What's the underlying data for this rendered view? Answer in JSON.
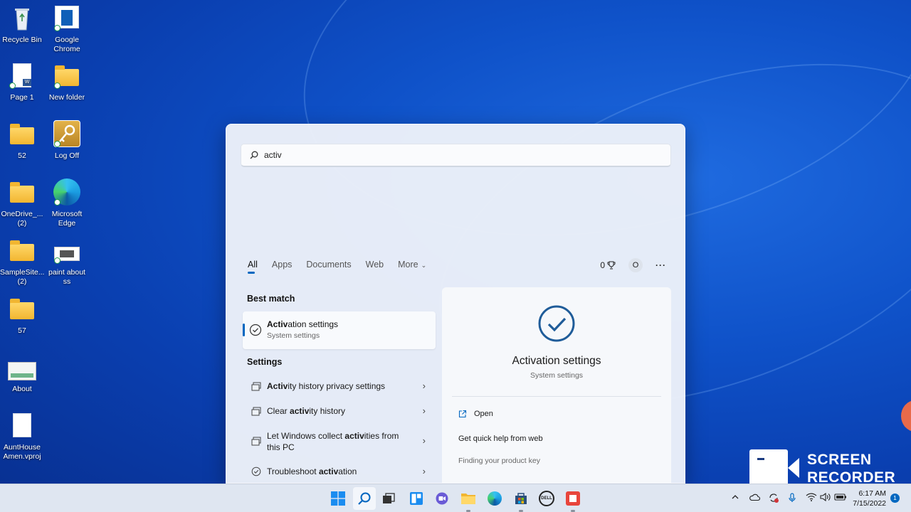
{
  "desktop": {
    "icons": [
      {
        "label": "Recycle Bin"
      },
      {
        "label": "Google\nChrome"
      },
      {
        "label": "Page 1"
      },
      {
        "label": "New folder"
      },
      {
        "label": "52"
      },
      {
        "label": "Log Off"
      },
      {
        "label": "OneDrive_...\n(2)"
      },
      {
        "label": "Microsoft\nEdge"
      },
      {
        "label": "SampleSite...\n(2)"
      },
      {
        "label": "paint about\nss"
      },
      {
        "label": "57"
      },
      {
        "label": "About"
      },
      {
        "label": "AuntHouse\nAmen.vproj"
      }
    ]
  },
  "search": {
    "value": "activ"
  },
  "tabs": [
    {
      "label": "All"
    },
    {
      "label": "Apps"
    },
    {
      "label": "Documents"
    },
    {
      "label": "Web"
    },
    {
      "label": "More"
    }
  ],
  "toolbar": {
    "points": "0",
    "profile_initial": "O",
    "more_label": "···"
  },
  "best_match": {
    "heading": "Best match",
    "title_bold": "Activ",
    "title_rest": "ation settings",
    "subtitle": "System settings"
  },
  "settings": {
    "heading": "Settings",
    "items": [
      {
        "pre": "",
        "bold": "Activ",
        "post": "ity history privacy settings"
      },
      {
        "pre": "Clear ",
        "bold": "activ",
        "post": "ity history"
      },
      {
        "pre": "Let Windows collect ",
        "bold": "activ",
        "post": "ities from this PC"
      },
      {
        "pre": "Troubleshoot ",
        "bold": "activ",
        "post": "ation"
      }
    ]
  },
  "preview": {
    "title": "Activation settings",
    "subtitle": "System settings",
    "actions": [
      {
        "label": "Open"
      },
      {
        "label": "Get quick help from web"
      },
      {
        "label": "Finding your product key"
      }
    ]
  },
  "watermark": {
    "line1": "SCREEN",
    "line2": "RECORDER"
  },
  "taskbar": {
    "time": "6:17 AM",
    "date": "7/15/2022",
    "notifications": "1"
  },
  "colors": {
    "accent": "#0067c0",
    "wallpaper": "#0f52c9",
    "taskbar": "#dfe6f1"
  }
}
